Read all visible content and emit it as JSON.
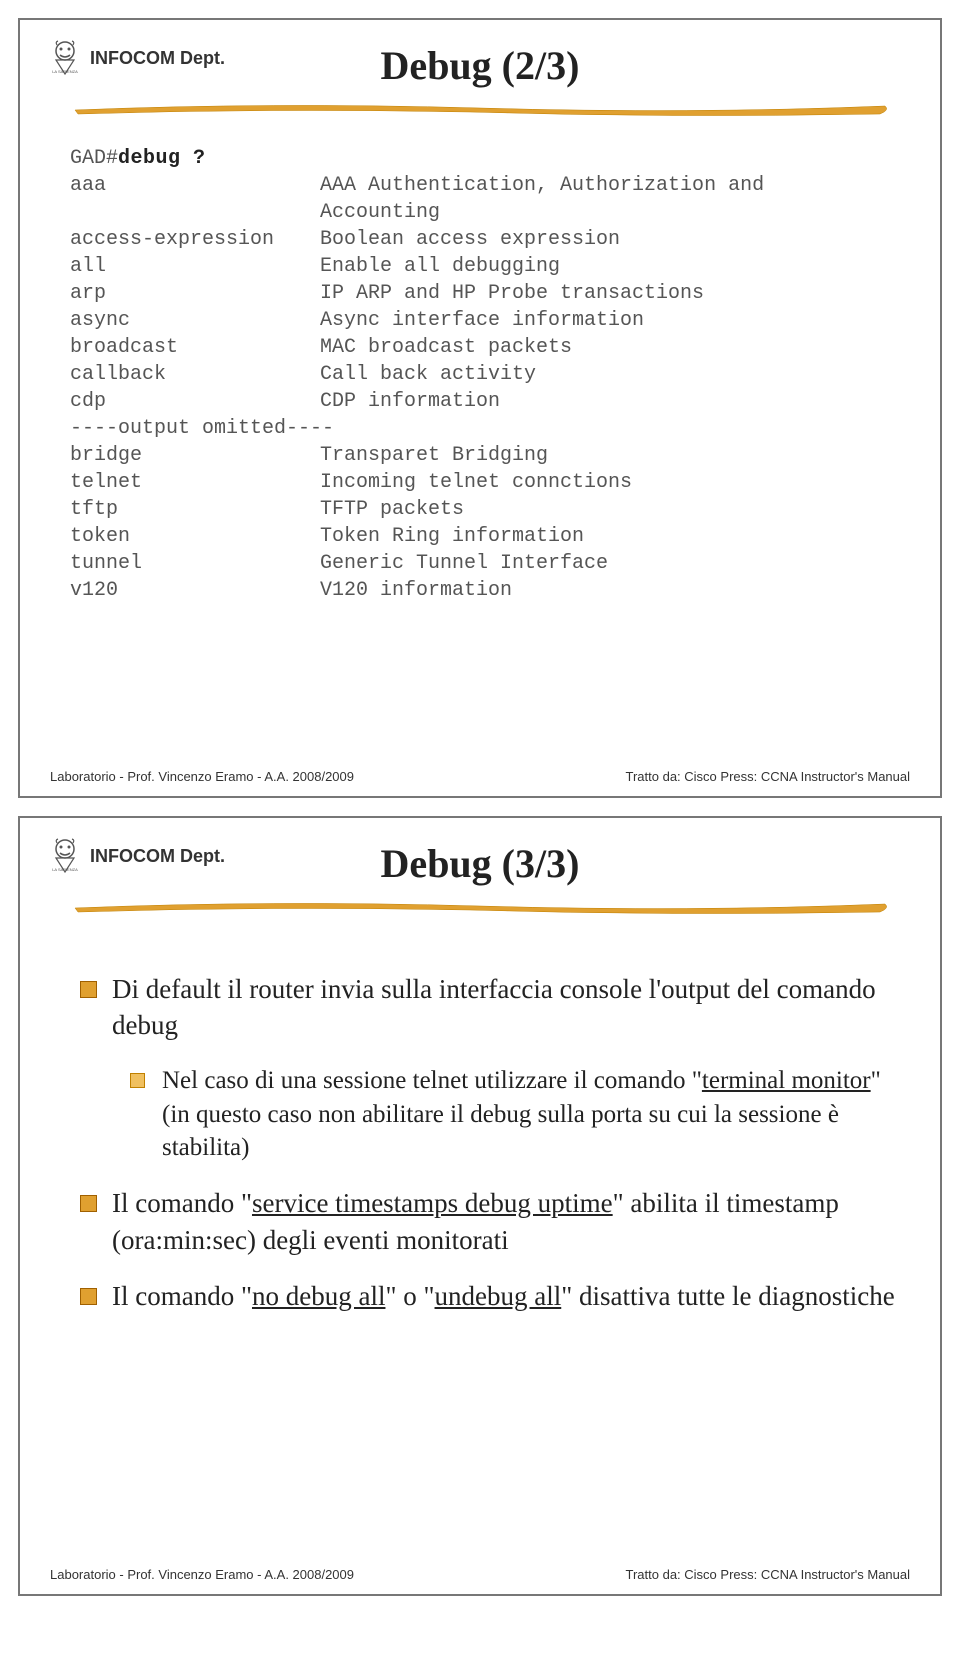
{
  "dept": "INFOCOM Dept.",
  "slide1": {
    "title": "Debug (2/3)",
    "cmd_prompt": "GAD#",
    "cmd": "debug ?",
    "omit": "----output omitted----",
    "rows_a": [
      {
        "k": "aaa",
        "d": "AAA Authentication, Authorization and Accounting"
      },
      {
        "k": "access-expression",
        "d": "Boolean access expression"
      },
      {
        "k": "all",
        "d": "Enable all debugging"
      },
      {
        "k": "arp",
        "d": "IP ARP and HP Probe transactions"
      },
      {
        "k": "async",
        "d": "Async interface information"
      },
      {
        "k": "broadcast",
        "d": "MAC broadcast packets"
      },
      {
        "k": "callback",
        "d": "Call back activity"
      },
      {
        "k": "cdp",
        "d": "CDP information"
      }
    ],
    "rows_b": [
      {
        "k": "bridge",
        "d": "Transparet Bridging"
      },
      {
        "k": "telnet",
        "d": "Incoming telnet connctions"
      },
      {
        "k": "tftp",
        "d": "TFTP packets"
      },
      {
        "k": "token",
        "d": "Token Ring information"
      },
      {
        "k": "tunnel",
        "d": "Generic Tunnel Interface"
      },
      {
        "k": "v120",
        "d": "V120 information"
      }
    ]
  },
  "slide2": {
    "title": "Debug (3/3)",
    "b1a": "Di default il router invia sulla interfaccia console l'output del comando debug",
    "b2_pre": "Nel caso di una sessione telnet utilizzare il comando \"",
    "b2_u": "terminal monitor",
    "b2_post": "\" (in questo caso non abilitare il debug sulla porta su cui la sessione è stabilita)",
    "b1b_pre": "Il comando \"",
    "b1b_u": "service timestamps debug uptime",
    "b1b_post": "\" abilita il timestamp (ora:min:sec) degli eventi monitorati",
    "b1c_pre": "Il comando \"",
    "b1c_u1": "no debug all",
    "b1c_mid": "\" o \"",
    "b1c_u2": "undebug all",
    "b1c_post": "\" disattiva tutte le diagnostiche"
  },
  "footer": {
    "left": "Laboratorio - Prof. Vincenzo Eramo - A.A. 2008/2009",
    "right": "Tratto da: Cisco Press: CCNA Instructor's Manual"
  }
}
